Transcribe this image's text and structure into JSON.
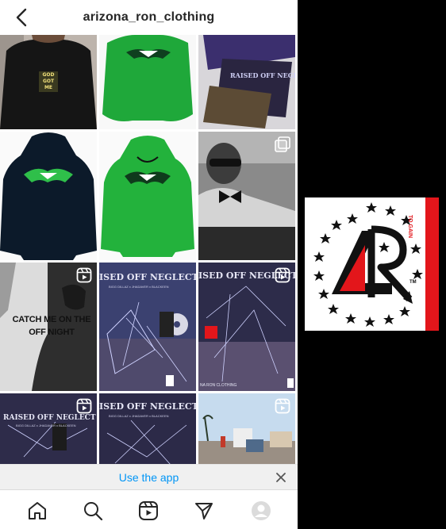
{
  "header": {
    "username": "arizona_ron_clothing",
    "back_icon": "chevron-left-icon"
  },
  "grid": {
    "tiles": [
      {
        "kind": "photo",
        "alt": "Model wearing black t-shirt",
        "shirt_text": [
          "GOD",
          "GOT",
          "ME"
        ]
      },
      {
        "kind": "photo",
        "alt": "Green eagle hoodie"
      },
      {
        "kind": "photo",
        "alt": "Flyers on table",
        "badge": "none"
      },
      {
        "kind": "photo",
        "alt": "Black eagle hoodie"
      },
      {
        "kind": "photo",
        "alt": "Green eagle hoodie front"
      },
      {
        "kind": "carousel",
        "alt": "Man in sunglasses",
        "badge": "multi-icon"
      },
      {
        "kind": "reel",
        "alt": "Catch me on the off night",
        "caption": [
          "CATCH ME ON THE",
          "OFF NIGHT"
        ],
        "badge": "reel-icon"
      },
      {
        "kind": "photo",
        "alt": "Raised Off Neglect Too album",
        "poster_title": "ISED OFF NEGLECT TOO",
        "credits": "BIGG DILLAZ x JHADAVER x BLACKEEN"
      },
      {
        "kind": "reel",
        "alt": "Raised Off Neglect Too poster",
        "poster_title": "ISED OFF NEGLECT TO",
        "footer": "NA RON CLOTHING",
        "badge": "reel-icon"
      },
      {
        "kind": "reel",
        "alt": "Raised Off Neglect Too banner",
        "poster_title": "RAISED OFF NEGLECT TOO",
        "credits": "BIGG DILLAZ x JHADAVER x BLACKEEN",
        "badge": "reel-icon"
      },
      {
        "kind": "photo",
        "alt": "Raised Off Neglect Too banner 2",
        "poster_title": "ISED OFF NEGLECT TOO",
        "credits": "BIGG DILLAZ x JHADAVER x BLACKEEN"
      },
      {
        "kind": "reel",
        "alt": "Street scene",
        "badge": "reel-icon"
      }
    ]
  },
  "app_banner": {
    "label": "Use the app",
    "close_icon": "close-icon"
  },
  "nav": {
    "items": [
      "home-icon",
      "search-icon",
      "reels-icon",
      "direct-icon",
      "profile-avatar"
    ]
  },
  "side_logo": {
    "letters": "AR",
    "tm": "TM",
    "tagline": "TO GAIN"
  },
  "colors": {
    "accent": "#0095f6",
    "hoodie_green": "#1fa83a",
    "logo_red": "#e3161b"
  }
}
